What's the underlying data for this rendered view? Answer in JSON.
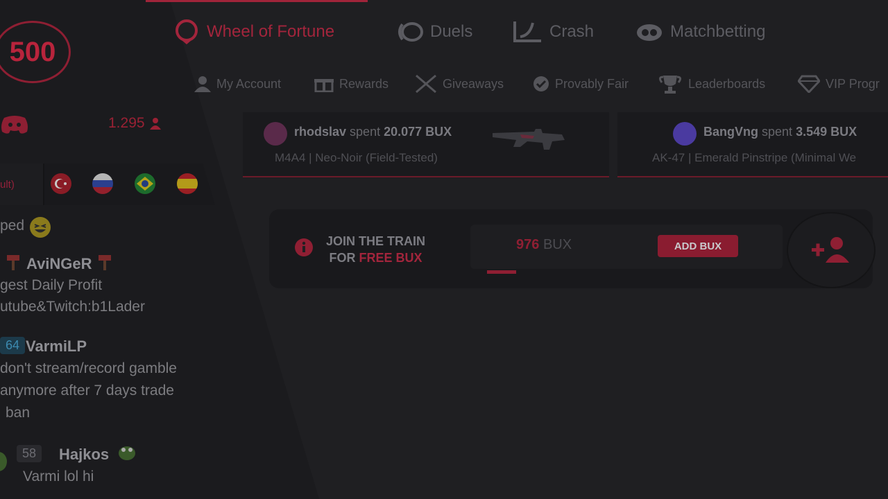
{
  "logo": {
    "text": "500"
  },
  "sidebar": {
    "online_count": "1.295",
    "lang_tab_label": "ult)",
    "flags": [
      "turkey",
      "russia",
      "brazil",
      "spain"
    ],
    "chat": [
      {
        "text": "ped"
      },
      {
        "name": "AviNGeR",
        "lines": [
          "gest Daily Profit",
          "utube&Twitch:b1Lader"
        ]
      },
      {
        "level": "64",
        "name": "VarmiLP",
        "lines": [
          "don't stream/record gamble",
          "anymore after 7 days trade",
          "ban"
        ]
      },
      {
        "level": "58",
        "name": "Hajkos",
        "lines": [
          "Varmi lol hi"
        ]
      }
    ]
  },
  "nav": {
    "main": [
      {
        "label": "Wheel of Fortune",
        "icon": "wheel-icon",
        "active": true
      },
      {
        "label": "Duels",
        "icon": "duels-icon"
      },
      {
        "label": "Crash",
        "icon": "crash-icon"
      },
      {
        "label": "Matchbetting",
        "icon": "matchbetting-icon"
      }
    ],
    "sub": [
      {
        "label": "My Account",
        "icon": "user-icon"
      },
      {
        "label": "Rewards",
        "icon": "gift-icon"
      },
      {
        "label": "Giveaways",
        "icon": "crossed-swords-icon"
      },
      {
        "label": "Provably Fair",
        "icon": "check-circle-icon"
      },
      {
        "label": "Leaderboards",
        "icon": "trophy-icon"
      },
      {
        "label": "VIP Progr",
        "icon": "diamond-icon"
      }
    ]
  },
  "drops": [
    {
      "user": "rhodslav",
      "spent_word": "spent",
      "amount": "20.077 BUX",
      "item": "M4A4 | Neo-Noir (Field-Tested)"
    },
    {
      "user": "BangVng",
      "spent_word": "spent",
      "amount": "3.549 BUX",
      "item": "AK-47 | Emerald Pinstripe (Minimal We"
    }
  ],
  "train": {
    "line1": "JOIN THE TRAIN",
    "line2_prefix": "FOR",
    "line2_highlight": "FREE BUX",
    "amount": "976",
    "unit": "BUX",
    "add_button": "ADD BUX",
    "progress_fraction": 0.09
  },
  "colors": {
    "accent": "#a3253c",
    "background": "#1f1f22",
    "sidebar": "#1b1b1e"
  }
}
